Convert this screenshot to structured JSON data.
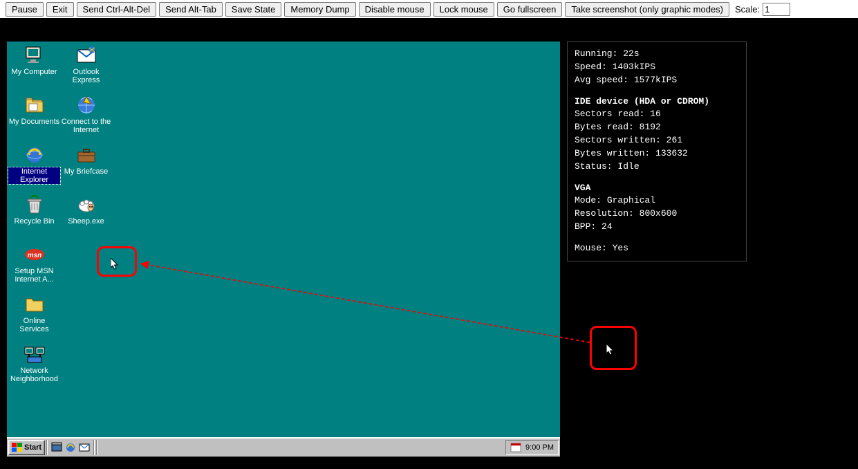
{
  "toolbar": {
    "buttons": [
      "Pause",
      "Exit",
      "Send Ctrl-Alt-Del",
      "Send Alt-Tab",
      "Save State",
      "Memory Dump",
      "Disable mouse",
      "Lock mouse",
      "Go fullscreen",
      "Take screenshot (only graphic modes)"
    ],
    "scale_label": "Scale:",
    "scale_value": "1"
  },
  "desktop": {
    "icons": [
      [
        {
          "label": "My Computer",
          "name": "my-computer-icon",
          "selected": false
        },
        {
          "label": "Outlook Express",
          "name": "outlook-express-icon",
          "selected": false
        }
      ],
      [
        {
          "label": "My Documents",
          "name": "my-documents-icon",
          "selected": false
        },
        {
          "label": "Connect to the Internet",
          "name": "connect-internet-icon",
          "selected": false
        }
      ],
      [
        {
          "label": "Internet Explorer",
          "name": "internet-explorer-icon",
          "selected": true
        },
        {
          "label": "My Briefcase",
          "name": "my-briefcase-icon",
          "selected": false
        }
      ],
      [
        {
          "label": "Recycle Bin",
          "name": "recycle-bin-icon",
          "selected": false
        },
        {
          "label": "Sheep.exe",
          "name": "sheep-exe-icon",
          "selected": false
        }
      ],
      [
        {
          "label": "Setup MSN Internet A...",
          "name": "msn-setup-icon",
          "selected": false
        }
      ],
      [
        {
          "label": "Online Services",
          "name": "online-services-icon",
          "selected": false
        }
      ],
      [
        {
          "label": "Network Neighborhood",
          "name": "network-neighborhood-icon",
          "selected": false
        }
      ]
    ]
  },
  "taskbar": {
    "start_label": "Start",
    "quicklaunch": [
      "desktop-ql-icon",
      "ie-ql-icon",
      "outlook-ql-icon"
    ],
    "clock": "9:00 PM"
  },
  "stats": {
    "running_label": "Running:",
    "running_value": "22s",
    "speed_label": "Speed:",
    "speed_value": "1403kIPS",
    "avg_label": "Avg speed:",
    "avg_value": "1577kIPS",
    "ide_header": "IDE device (HDA or CDROM)",
    "sectors_read_label": "Sectors read:",
    "sectors_read_value": "16",
    "bytes_read_label": "Bytes read:",
    "bytes_read_value": "8192",
    "sectors_written_label": "Sectors written:",
    "sectors_written_value": "261",
    "bytes_written_label": "Bytes written:",
    "bytes_written_value": "133632",
    "status_label": "Status:",
    "status_value": "Idle",
    "vga_header": "VGA",
    "mode_label": "Mode:",
    "mode_value": "Graphical",
    "res_label": "Resolution:",
    "res_value": "800x600",
    "bpp_label": "BPP:",
    "bpp_value": "24",
    "mouse_label": "Mouse:",
    "mouse_value": "Yes"
  }
}
